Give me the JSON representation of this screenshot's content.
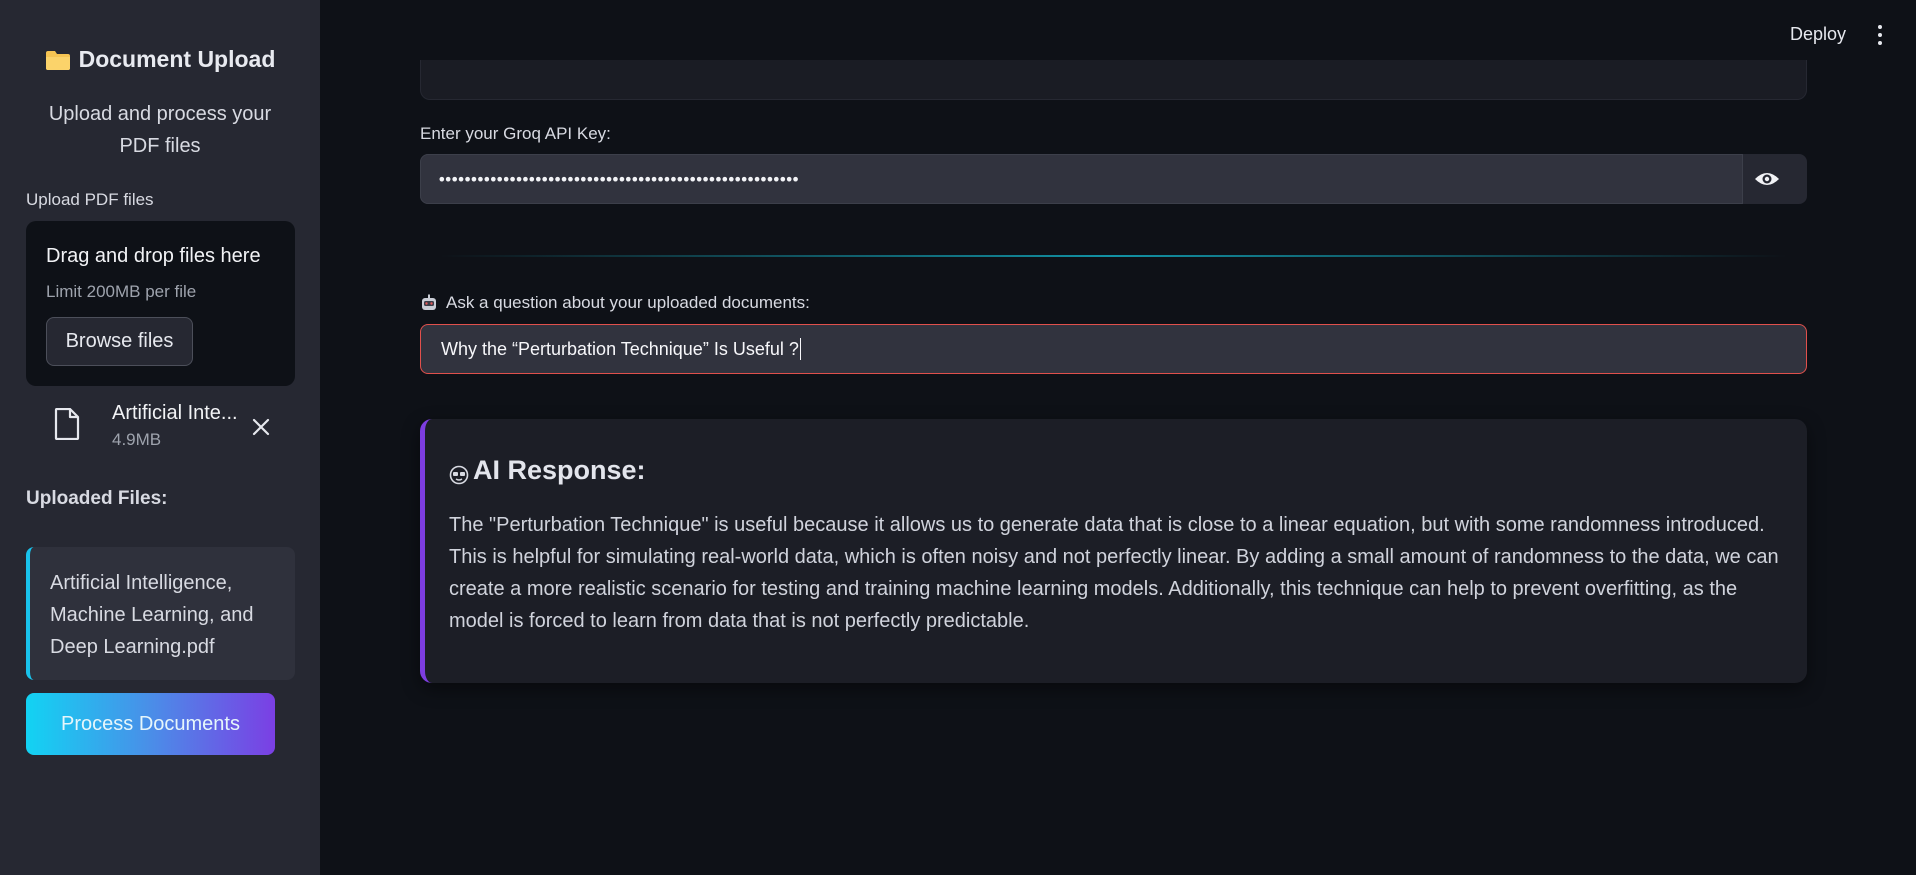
{
  "sidebar": {
    "title": "Document Upload",
    "subtitle": "Upload and process your PDF files",
    "upload_label": "Upload PDF files",
    "dropzone": {
      "title": "Drag and drop files here",
      "limit": "Limit 200MB per file",
      "browse_label": "Browse files"
    },
    "file": {
      "name": "Artificial Inte...",
      "size": "4.9MB"
    },
    "uploaded_heading": "Uploaded Files:",
    "uploaded_files": [
      "Artificial Intelligence, Machine Learning, and Deep Learning.pdf"
    ],
    "process_label": "Process Documents"
  },
  "header": {
    "deploy_label": "Deploy"
  },
  "main": {
    "api_label": "Enter your Groq API Key:",
    "api_value": "••••••••••••••••••••••••••••••••••••••••••••••••••••••••",
    "question_label": "Ask a question about your uploaded documents:",
    "question_value": "Why the “Perturbation Technique” Is Useful ?",
    "response_title": "AI Response:",
    "response_text": "The \"Perturbation Technique\" is useful because it allows us to generate data that is close to a linear equation, but with some randomness introduced. This is helpful for simulating real-world data, which is often noisy and not perfectly linear. By adding a small amount of randomness to the data, we can create a more realistic scenario for testing and training machine learning models. Additionally, this technique can help to prevent overfitting, as the model is forced to learn from data that is not perfectly predictable."
  },
  "colors": {
    "background": "#0e1117",
    "sidebar": "#262832",
    "accent_cyan": "#19c3ec",
    "accent_purple": "#7d3de0",
    "error_border": "#e0504c"
  },
  "icons": [
    "folder-icon",
    "file-icon",
    "close-icon",
    "eye-icon",
    "robot-icon",
    "ai-emoji-icon",
    "kebab-menu-icon"
  ]
}
